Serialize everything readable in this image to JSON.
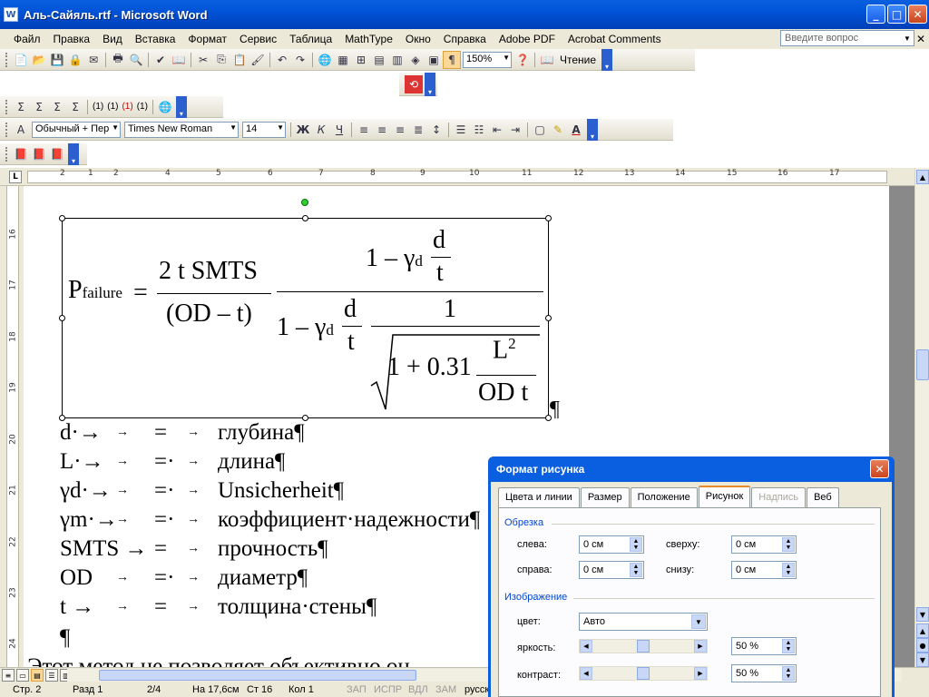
{
  "window": {
    "title": "Аль-Сайяль.rtf - Microsoft Word",
    "app_icon": "W"
  },
  "menu": [
    "Файл",
    "Правка",
    "Вид",
    "Вставка",
    "Формат",
    "Сервис",
    "Таблица",
    "MathType",
    "Окно",
    "Справка",
    "Adobe PDF",
    "Acrobat Comments"
  ],
  "ask_box": {
    "placeholder": "Введите вопрос"
  },
  "toolbar": {
    "zoom": "150%",
    "reading_label": "Чтение"
  },
  "mathtype_toolbar": {
    "labels": [
      "(1)",
      "(1)",
      "(1)",
      "(1)"
    ]
  },
  "formatting": {
    "style": "Обычный + Пер",
    "font": "Times New Roman",
    "size": "14",
    "bold": "Ж",
    "italic": "К",
    "underline": "Ч"
  },
  "ruler": {
    "h_ticks": [
      "2",
      "1",
      "1",
      "2",
      "3",
      "4",
      "5",
      "6",
      "7",
      "8",
      "9",
      "10",
      "11",
      "12",
      "13",
      "14",
      "15",
      "16",
      "17"
    ],
    "v_ticks": [
      "16",
      "17",
      "18",
      "19",
      "20",
      "21",
      "22",
      "23",
      "24"
    ]
  },
  "document": {
    "equation": {
      "p": "P",
      "p_sub": "failure",
      "eq": "=",
      "num1": "2 t SMTS",
      "den1": "(OD – t)",
      "n2a": "1 – γ",
      "n2a_sub": "d",
      "n2_frac_num": "d",
      "n2_frac_den": "t",
      "d2a": "1 – γ",
      "d2a_sub": "d",
      "d2_frac_num": "d",
      "d2_frac_den": "t",
      "d2_one": "1",
      "sqrt_body": "1 + 0.31",
      "sqrt_num": "L",
      "sqrt_num_sup": "2",
      "sqrt_den": "OD t"
    },
    "pilcrow": "¶",
    "definitions": [
      {
        "sym": "d·→",
        "tab": "→",
        "eq": "=",
        "desc": "глубина¶"
      },
      {
        "sym": "L·→",
        "tab": "→",
        "eq": "=·",
        "desc": "длина¶"
      },
      {
        "sym": "γd·→",
        "tab": "→",
        "eq": "=·",
        "desc": "Unsicherheit¶"
      },
      {
        "sym": "γm·→",
        "tab": "→",
        "eq": "=·",
        "desc": "коэффициент·надежности¶"
      },
      {
        "sym": "SMTS →",
        "tab": "",
        "eq": "=",
        "desc": "прочность¶"
      },
      {
        "sym": "OD",
        "tab": "→",
        "eq": "=·",
        "desc": "диаметр¶"
      },
      {
        "sym": "t →",
        "tab": "→",
        "eq": "=",
        "desc": "толщина·стены¶"
      }
    ],
    "empty_para": "¶",
    "partial_line": "Этот метод не позволяет объективно оц"
  },
  "status": {
    "page": "Стр. 2",
    "section": "Разд 1",
    "pages": "2/4",
    "at": "На 17,6см",
    "line": "Ст 16",
    "col": "Кол 1",
    "rec": "ЗАП",
    "trk": "ИСПР",
    "ext": "ВДЛ",
    "ovr": "ЗАМ",
    "lang": "русск"
  },
  "dialog": {
    "title": "Формат рисунка",
    "tabs": [
      "Цвета и линии",
      "Размер",
      "Положение",
      "Рисунок",
      "Надпись",
      "Веб"
    ],
    "crop_group": "Обрезка",
    "left_label": "слева:",
    "left_val": "0 см",
    "top_label": "сверху:",
    "top_val": "0 см",
    "right_label": "справа:",
    "right_val": "0 см",
    "bottom_label": "снизу:",
    "bottom_val": "0 см",
    "image_group": "Изображение",
    "color_label": "цвет:",
    "color_val": "Авто",
    "brightness_label": "яркость:",
    "brightness_val": "50 %",
    "brightness_level": 0.5,
    "contrast_label": "контраст:",
    "contrast_val": "50 %",
    "contrast_level": 0.5
  }
}
